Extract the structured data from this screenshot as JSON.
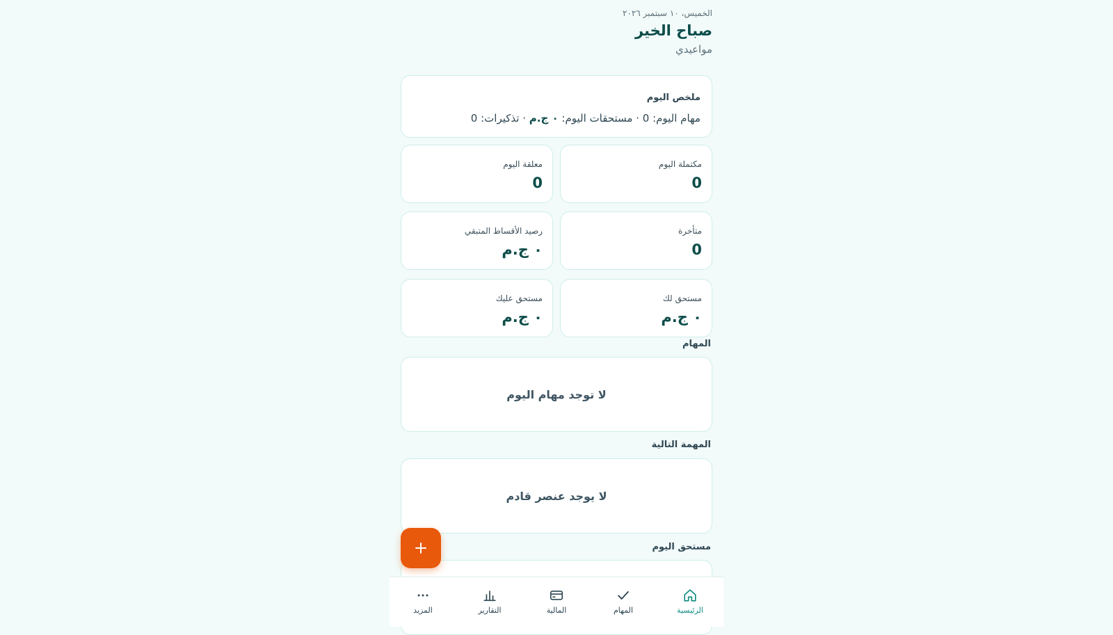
{
  "header": {
    "date": "الخميس، ١٠ سبتمبر ٢٠٢٦",
    "greeting": "صباح الخير",
    "app_name": "مواعيدي"
  },
  "summary": {
    "title": "ملخص اليوم",
    "tasks_part": "مهام اليوم: 0 · ",
    "dues_label": "مستحقات اليوم: ",
    "dues_value": "٠ ج.م",
    "reminders_part": " · تذكيرات: 0"
  },
  "stats": [
    {
      "label": "مكتملة اليوم",
      "value": "0"
    },
    {
      "label": "معلقة اليوم",
      "value": "0"
    },
    {
      "label": "متأخرة",
      "value": "0"
    },
    {
      "label": "رصيد الأقساط المتبقي",
      "value": "٠ ج.م"
    },
    {
      "label": "مستحق لك",
      "value": "٠ ج.م"
    },
    {
      "label": "مستحق عليك",
      "value": "٠ ج.م"
    }
  ],
  "sections": {
    "tasks": {
      "title": "المهام",
      "empty": "لا توجد مهام اليوم"
    },
    "next_task": {
      "title": "المهمة التالية",
      "empty": "لا يوجد عنصر قادم"
    },
    "due_today": {
      "title": "مستحق اليوم"
    }
  },
  "fab": {
    "icon": "plus-icon"
  },
  "nav": [
    {
      "label": "الرئيسية",
      "icon": "home-icon",
      "active": true
    },
    {
      "label": "المهام",
      "icon": "check-icon",
      "active": false
    },
    {
      "label": "المالية",
      "icon": "wallet-icon",
      "active": false
    },
    {
      "label": "التقارير",
      "icon": "bar-chart-icon",
      "active": false
    },
    {
      "label": "المزيد",
      "icon": "more-icon",
      "active": false
    }
  ],
  "colors": {
    "accent": "#0f8b80",
    "primary_text": "#0d4d4a",
    "fab": "#e8590c",
    "background": "#f2fbfa"
  }
}
